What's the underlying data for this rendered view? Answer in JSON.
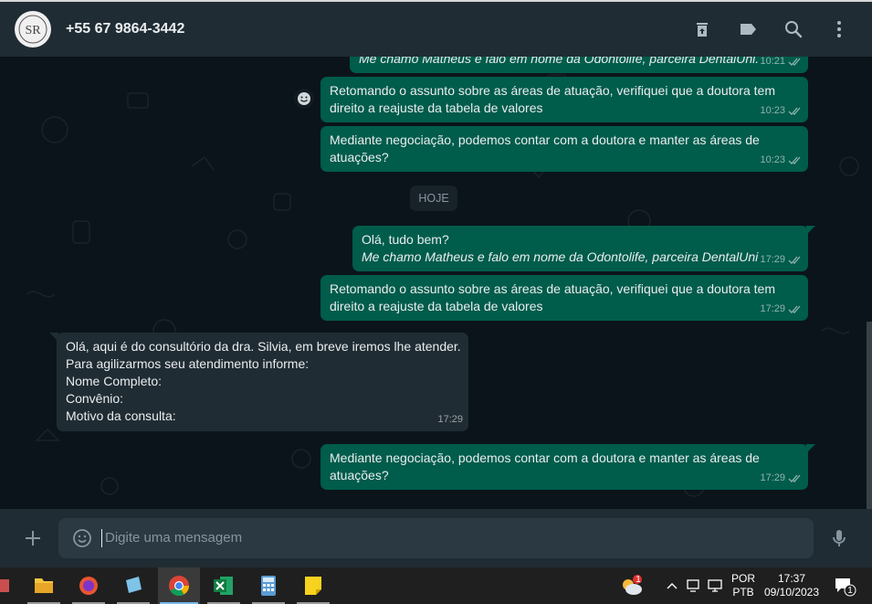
{
  "header": {
    "contact_name": "+55 67 9864-3442",
    "avatar_initials": "SR",
    "icons": [
      "archive-icon",
      "label-icon",
      "search-icon",
      "menu-icon"
    ]
  },
  "colors": {
    "outgoing_bubble": "#005c4b",
    "incoming_bubble": "#202c33",
    "panel": "#202c33",
    "background": "#0b141a"
  },
  "messages": [
    {
      "dir": "out",
      "lines": [
        "Me chamo Matheus e falo em nome da Odontolife, parceira DentalUni."
      ],
      "italic": [
        0
      ],
      "time": "10:21",
      "status": "read"
    },
    {
      "dir": "out",
      "lines": [
        "Retomando o assunto sobre as áreas de atuação, verifiquei que a doutora tem",
        "direito a reajuste da tabela de valores"
      ],
      "italic": [],
      "time": "10:23",
      "status": "read"
    },
    {
      "dir": "out",
      "lines": [
        "Mediante negociação, podemos contar com a doutora e manter as áreas de",
        "atuações?"
      ],
      "italic": [],
      "time": "10:23",
      "status": "read"
    },
    {
      "dir": "out",
      "lines": [
        "Olá, tudo bem?",
        "Me chamo Matheus e falo em nome da Odontolife, parceira DentalUni"
      ],
      "italic": [
        1
      ],
      "time": "17:29",
      "status": "read"
    },
    {
      "dir": "out",
      "lines": [
        "Retomando o assunto sobre as áreas de atuação, verifiquei que a doutora tem",
        "direito a reajuste da tabela de valores"
      ],
      "italic": [],
      "time": "17:29",
      "status": "read"
    },
    {
      "dir": "in",
      "lines": [
        "Olá, aqui é do consultório da dra. Silvia, em breve iremos lhe atender.",
        "Para agilizarmos seu atendimento informe:",
        "Nome Completo:",
        "Convênio:",
        "Motivo da consulta:"
      ],
      "italic": [],
      "time": "17:29",
      "status": ""
    },
    {
      "dir": "out",
      "lines": [
        "Mediante negociação, podemos contar com a doutora e manter as áreas de",
        "atuações?"
      ],
      "italic": [],
      "time": "17:29",
      "status": "read"
    }
  ],
  "day_separator": "HOJE",
  "composer": {
    "placeholder": "Digite uma mensagem"
  },
  "taskbar": {
    "apps": [
      "file-explorer",
      "firefox",
      "notepad",
      "chrome",
      "excel",
      "calculator",
      "sticky-notes"
    ],
    "active_app": "chrome",
    "language_top": "POR",
    "language_bottom": "PTB",
    "time": "17:37",
    "date": "09/10/2023",
    "weather_badge": "1",
    "notification_count": "1"
  }
}
